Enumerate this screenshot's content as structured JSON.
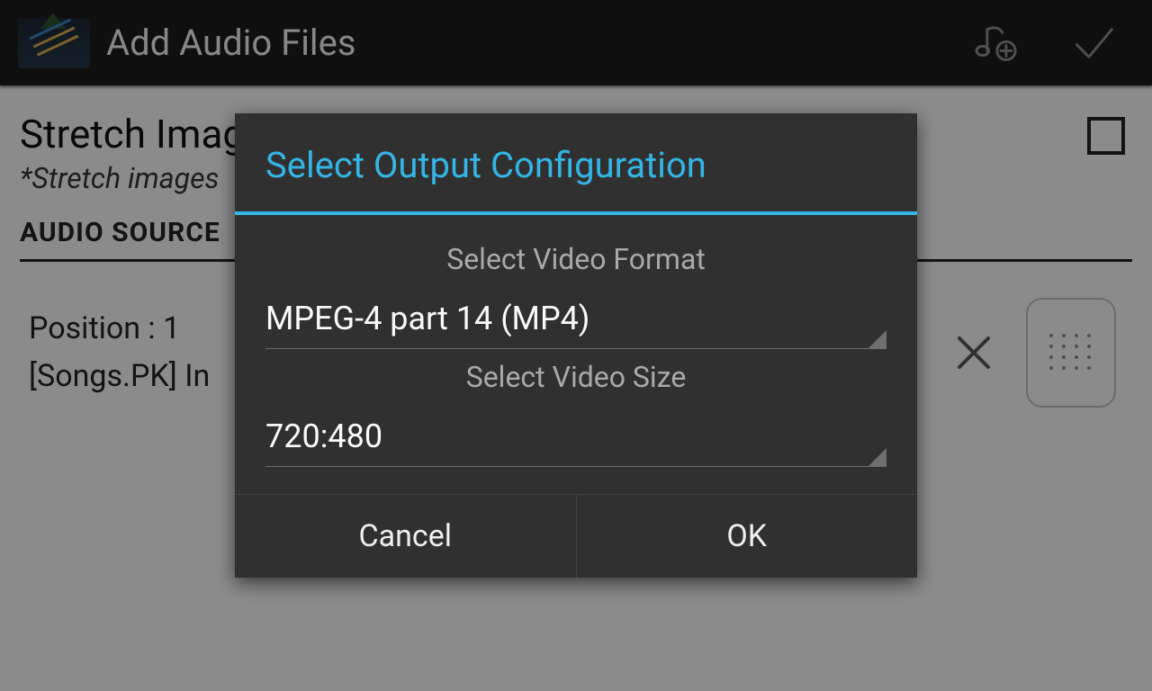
{
  "actionbar": {
    "title": "Add Audio Files"
  },
  "background": {
    "stretch_heading": "Stretch Imag",
    "stretch_sub": "*Stretch images",
    "section_header": "AUDIO SOURCE",
    "row_position": "Position : 1",
    "row_filename": "[Songs.PK] In"
  },
  "dialog": {
    "title": "Select Output Configuration",
    "format_label": "Select Video Format",
    "format_value": "MPEG-4 part 14 (MP4)",
    "size_label": "Select Video Size",
    "size_value": "720:480",
    "cancel": "Cancel",
    "ok": "OK"
  }
}
